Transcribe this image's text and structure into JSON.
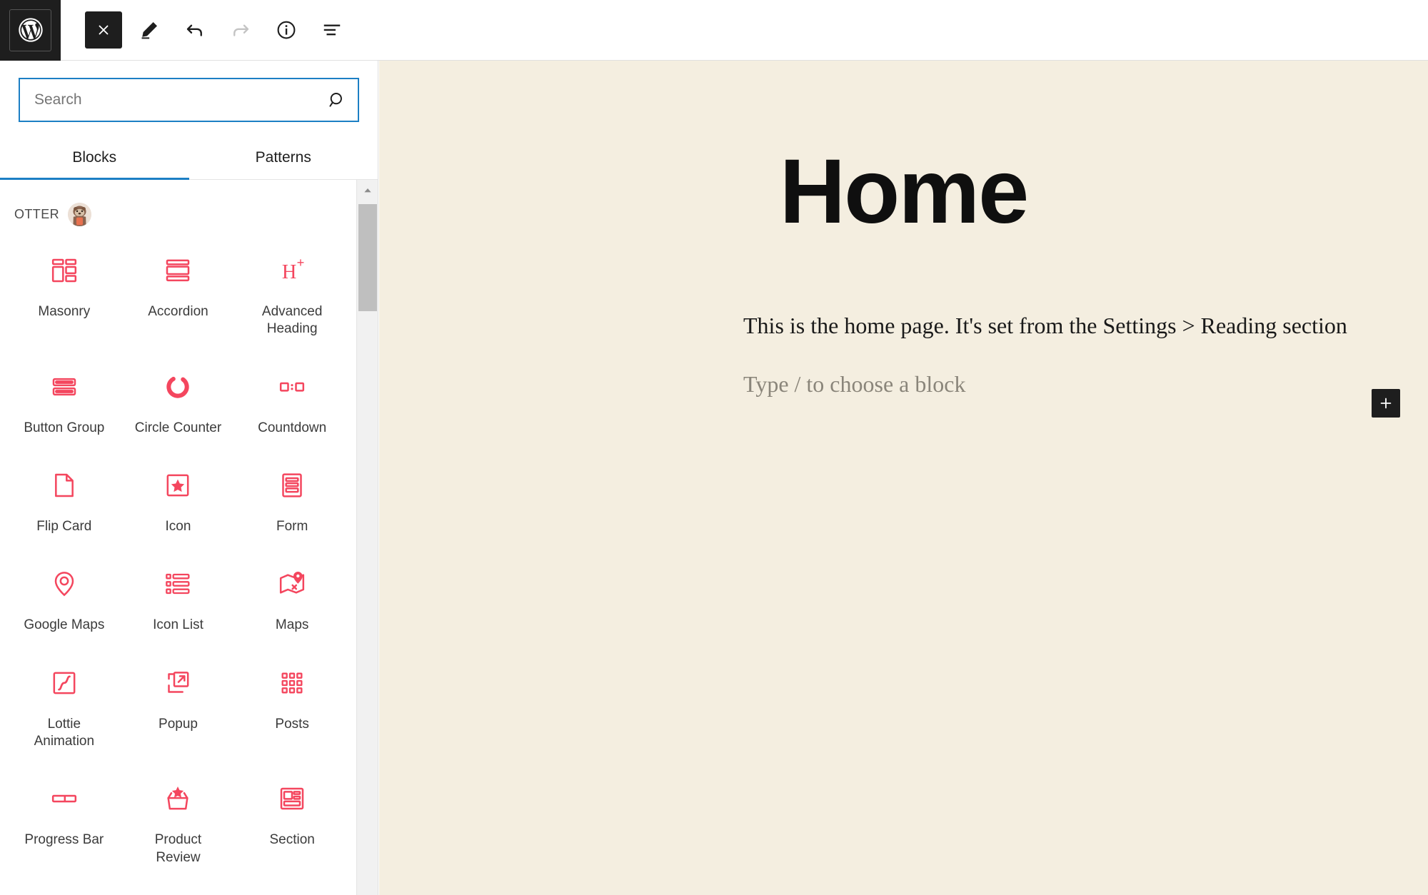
{
  "topbar": {
    "logo_label": "WordPress",
    "buttons": [
      {
        "name": "close-editor-button",
        "label": "Close",
        "icon": "close-icon",
        "state": "dark"
      },
      {
        "name": "edit-tool-button",
        "label": "Edit",
        "icon": "pencil-icon",
        "state": "normal"
      },
      {
        "name": "undo-button",
        "label": "Undo",
        "icon": "undo-icon",
        "state": "normal"
      },
      {
        "name": "redo-button",
        "label": "Redo",
        "icon": "redo-icon",
        "state": "disabled"
      },
      {
        "name": "details-info-button",
        "label": "Details",
        "icon": "info-icon",
        "state": "normal"
      },
      {
        "name": "list-view-button",
        "label": "List View",
        "icon": "list-view-icon",
        "state": "normal"
      }
    ]
  },
  "inserter": {
    "search": {
      "value": "",
      "placeholder": "Search",
      "icon": "search-icon"
    },
    "tabs": [
      {
        "label": "Blocks",
        "active": true
      },
      {
        "label": "Patterns",
        "active": false
      }
    ],
    "category": {
      "title": "OTTER",
      "avatar": "otter-mascot-icon"
    },
    "blocks": [
      {
        "label": "Masonry",
        "icon": "masonry-icon"
      },
      {
        "label": "Accordion",
        "icon": "accordion-icon"
      },
      {
        "label": "Advanced Heading",
        "icon": "advanced-heading-icon"
      },
      {
        "label": "Button Group",
        "icon": "button-group-icon"
      },
      {
        "label": "Circle Counter",
        "icon": "circle-counter-icon"
      },
      {
        "label": "Countdown",
        "icon": "countdown-icon"
      },
      {
        "label": "Flip Card",
        "icon": "flip-card-icon"
      },
      {
        "label": "Icon",
        "icon": "star-square-icon"
      },
      {
        "label": "Form",
        "icon": "form-icon"
      },
      {
        "label": "Google Maps",
        "icon": "map-pin-icon"
      },
      {
        "label": "Icon List",
        "icon": "icon-list-icon"
      },
      {
        "label": "Maps",
        "icon": "folded-map-icon"
      },
      {
        "label": "Lottie Animation",
        "icon": "lottie-curve-icon"
      },
      {
        "label": "Popup",
        "icon": "popup-external-icon"
      },
      {
        "label": "Posts",
        "icon": "posts-grid-icon"
      },
      {
        "label": "Progress Bar",
        "icon": "progress-bar-icon"
      },
      {
        "label": "Product Review",
        "icon": "product-review-icon"
      },
      {
        "label": "Section",
        "icon": "section-layout-icon"
      }
    ],
    "scrollbar": {
      "up_arrow": "chevron-up-icon"
    }
  },
  "canvas": {
    "title": "Home",
    "paragraph": "This is the home page. It's set from the Settings > Reading section",
    "placeholder": "Type / to choose a block",
    "add_block": {
      "icon": "plus-icon",
      "label": "Add block"
    },
    "background_color": "#f4eee0"
  },
  "colors": {
    "accent_blue": "#1c7fc4",
    "block_icon_red": "#f4465e",
    "dark": "#1e1e1e",
    "canvas_bg": "#f4eee0"
  }
}
